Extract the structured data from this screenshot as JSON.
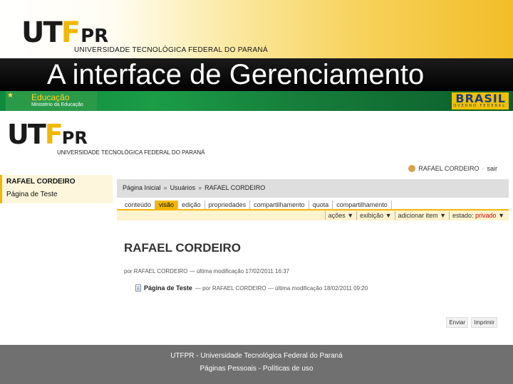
{
  "slide": {
    "logo_ut": "UT",
    "logo_f": "F",
    "logo_pr": "PR",
    "university": "UNIVERSIDADE TECNOLÓGICA FEDERAL DO PARANÁ",
    "title": "A interface de Gerenciamento"
  },
  "gov_bar": {
    "education": "Educação",
    "ministry": "Ministério da Educação",
    "brasil": "BRASIL",
    "brasil_sub": "GOVERNO FEDERAL"
  },
  "site": {
    "logo_ut": "UT",
    "logo_f": "F",
    "logo_pr": "PR",
    "university": "UNIVERSIDADE TECNOLÓGICA FEDERAL DO PARANÁ",
    "user_name": "RAFAEL CORDEIRO",
    "logout": "sair"
  },
  "sidebar": {
    "user": "RAFAEL CORDEIRO",
    "page": "Página de Teste"
  },
  "breadcrumb": [
    "Página Inicial",
    "Usuários",
    "RAFAEL CORDEIRO"
  ],
  "breadcrumb_sep": "»",
  "tabs": [
    {
      "label": "conteúdo"
    },
    {
      "label": "visão",
      "active": true
    },
    {
      "label": "edição"
    },
    {
      "label": "propriedades"
    },
    {
      "label": "compartilhamento"
    },
    {
      "label": "quota"
    },
    {
      "label": "compartilhamento"
    }
  ],
  "actions": {
    "acoes": "ações ▼",
    "exibicao": "exibição ▼",
    "adicionar": "adicionar item ▼",
    "estado_label": "estado: ",
    "estado_value": "privado",
    "estado_arrow": " ▼"
  },
  "content": {
    "title": "RAFAEL CORDEIRO",
    "byline": "por RAFAEL CORDEIRO — última modificação 17/02/2011 16:37",
    "item_name": "Página de Teste",
    "item_meta": "— por RAFAEL CORDEIRO — última modificação 18/02/2011 09:20",
    "send": "Enviar",
    "print": "Imprimir"
  },
  "footer": {
    "line1": "UTFPR - Universidade Tecnológica Federal do Paraná",
    "line2": "Páginas Pessoais - Políticas de uso"
  },
  "colors": {
    "accent_yellow": "#f2b705",
    "gov_green": "#1b9c47",
    "footer_gray": "#707070"
  }
}
